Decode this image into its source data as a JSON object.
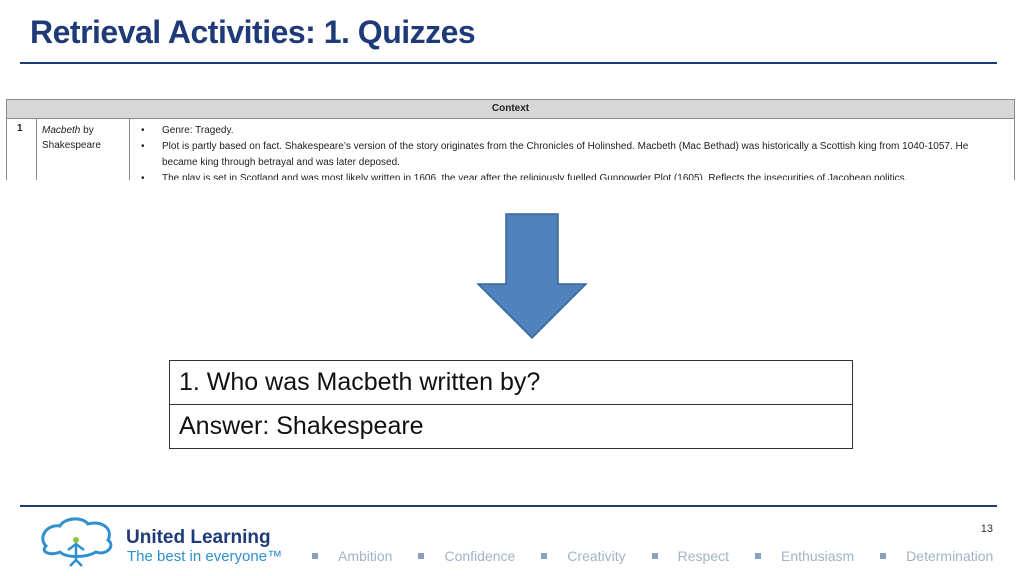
{
  "slide": {
    "title": "Retrieval Activities: 1. Quizzes",
    "page_number": "13"
  },
  "context_table": {
    "header": "Context",
    "row_number": "1",
    "title_italic": "Macbeth",
    "title_rest": " by Shakespeare",
    "bullets": [
      "Genre: Tragedy.",
      "Plot is partly based on fact. Shakespeare’s version of the story originates from the Chronicles of Holinshed. Macbeth (Mac Bethad) was historically a Scottish king from 1040-1057. He became king through betrayal and was later deposed.",
      "The play is set in Scotland and was most likely written in 1606, the year after the religiously fuelled Gunpowder Plot (1605). Reflects the insecurities of Jacobean politics."
    ]
  },
  "arrow": {
    "icon": "down-arrow-icon",
    "color": "#4f81bd"
  },
  "quiz": {
    "question": "1. Who was Macbeth written by?",
    "answer": "Answer: Shakespeare"
  },
  "footer": {
    "brand": "United Learning",
    "tagline": "The best in everyone™",
    "values": [
      "Ambition",
      "Confidence",
      "Creativity",
      "Respect",
      "Enthusiasm",
      "Determination"
    ],
    "colors": {
      "brand": "#1f3a78",
      "tagline": "#2f8fcf",
      "values": "#9fb4c8"
    }
  }
}
